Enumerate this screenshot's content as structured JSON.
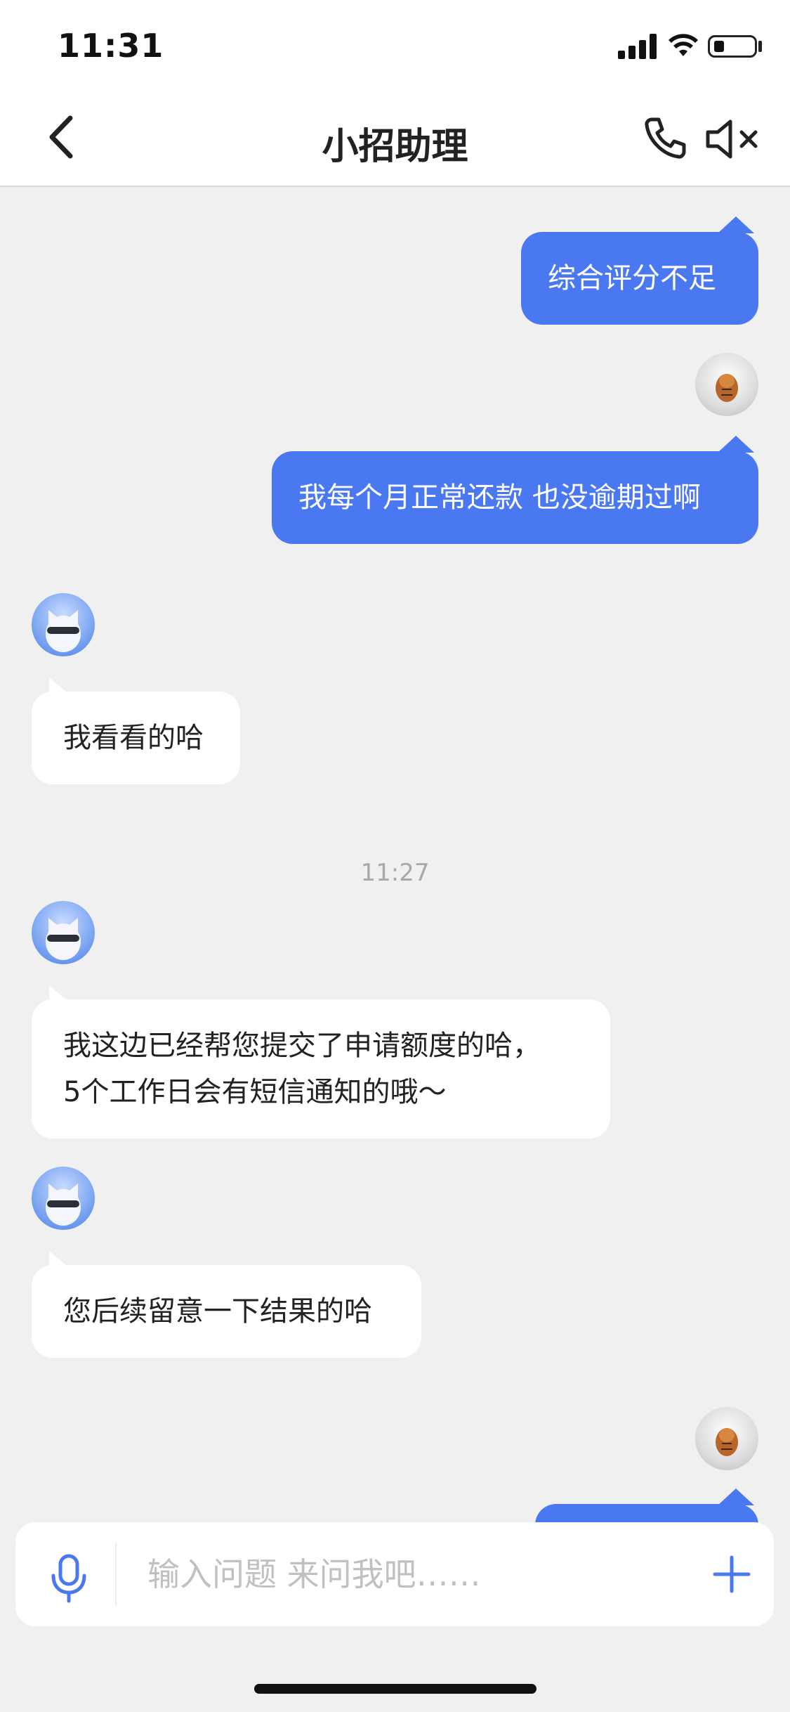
{
  "status_bar": {
    "time": "11:31"
  },
  "header": {
    "title": "小招助理",
    "back_icon": "chevron-left-icon",
    "call_icon": "phone-icon",
    "mute_icon": "speaker-mute-icon"
  },
  "messages": [
    {
      "from": "user",
      "text": "综合评分不足"
    },
    {
      "from": "user",
      "text": "我每个月正常还款 也没逾期过啊"
    },
    {
      "from": "bot",
      "text": "我看看的哈"
    },
    {
      "timestamp": "11:27"
    },
    {
      "from": "bot",
      "lines": [
        "我这边已经帮您提交了申请额度的哈，",
        "5个工作日会有短信通知的哦～"
      ]
    },
    {
      "from": "bot",
      "text": "您后续留意一下结果的哈"
    },
    {
      "from": "user",
      "text": ""
    }
  ],
  "input": {
    "placeholder": "输入问题 来问我吧……",
    "mic_icon": "microphone-icon",
    "plus_icon": "plus-icon"
  },
  "colors": {
    "accent": "#4a78f0",
    "background": "#f0f0f0",
    "bot_bubble": "#ffffff"
  }
}
